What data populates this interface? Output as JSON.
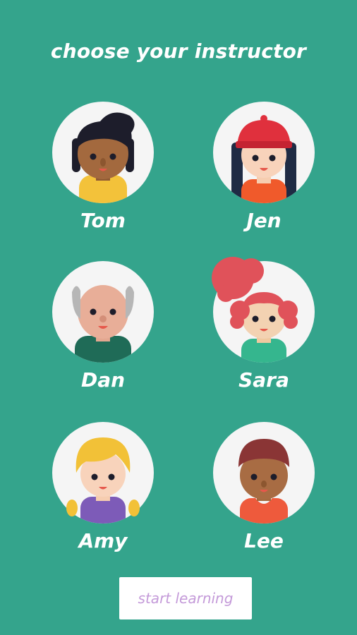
{
  "header": {
    "title": "choose your instructor"
  },
  "instructors": [
    {
      "name": "Tom",
      "icon": "tom-avatar-icon"
    },
    {
      "name": "Jen",
      "icon": "jen-avatar-icon"
    },
    {
      "name": "Dan",
      "icon": "dan-avatar-icon"
    },
    {
      "name": "Sara",
      "icon": "sara-avatar-icon"
    },
    {
      "name": "Amy",
      "icon": "amy-avatar-icon"
    },
    {
      "name": "Lee",
      "icon": "lee-avatar-icon"
    }
  ],
  "footer": {
    "start_label": "start learning"
  },
  "colors": {
    "background": "#34a48c",
    "avatar_circle": "#f5f5f5",
    "text": "#ffffff",
    "button_text": "#c49ad9"
  }
}
